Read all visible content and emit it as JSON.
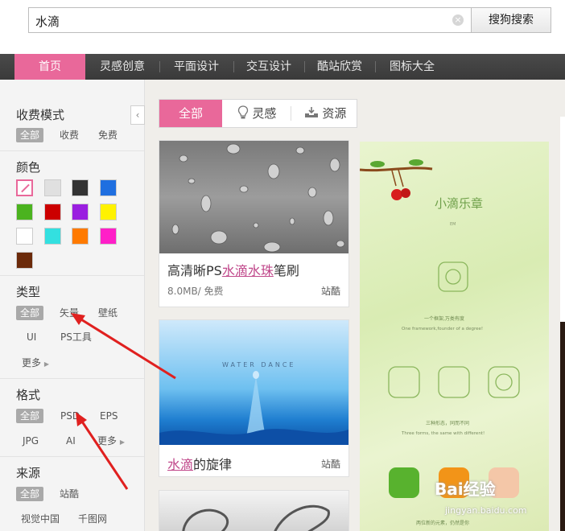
{
  "search": {
    "value": "水滴",
    "clear_icon": "close-circle-icon",
    "button_label": "搜狗搜索"
  },
  "nav": {
    "items": [
      "首页",
      "灵感创意",
      "平面设计",
      "交互设计",
      "酷站欣赏",
      "图标大全"
    ],
    "active": "首页",
    "accent": "#e9689a"
  },
  "sidebar": {
    "collapse_icon": "chevron-left-icon",
    "fee": {
      "title": "收费模式",
      "options": [
        "全部",
        "收费",
        "免费"
      ]
    },
    "color": {
      "title": "颜色",
      "swatches": [
        "none",
        "#e0e0e0",
        "#333333",
        "#1f6fe0",
        "#4bb31f",
        "#cc0000",
        "#9a1fe0",
        "#fff200",
        "#ffffff",
        "#33e0e0",
        "#ff7a00",
        "#ff1fc8",
        "#6b2a0a"
      ]
    },
    "type": {
      "title": "类型",
      "options": [
        "全部",
        "矢量",
        "壁纸",
        "UI",
        "PS工具"
      ],
      "more": "更多"
    },
    "format": {
      "title": "格式",
      "options": [
        "全部",
        "PSD",
        "EPS",
        "JPG",
        "AI"
      ],
      "more": "更多"
    },
    "source": {
      "title": "来源",
      "options": [
        "全部",
        "站酷",
        "视觉中国",
        "千图网"
      ]
    }
  },
  "tabs": [
    {
      "label": "全部",
      "icon": ""
    },
    {
      "label": "灵感",
      "icon": "lightbulb-icon"
    },
    {
      "label": "资源",
      "icon": "download-tray-icon"
    }
  ],
  "cards": {
    "c1": {
      "title_pre": "高清晰PS",
      "title_hl": "水滴水珠",
      "title_post": "笔刷",
      "meta": "8.0MB/ 免费",
      "source": "站酷"
    },
    "c2": {
      "title_hl": "水滴",
      "title_post": "的旋律",
      "source": "站酷",
      "image_text": "WATER DANCE"
    },
    "ui": {
      "title": "小滴乐章",
      "em": "EM",
      "line1": "一个框架,万类有度",
      "line1_en": "One framework,founder of a degree!",
      "line2": "三种形态，同而不同",
      "line2_en": "Three forms, the same with different!",
      "line3": "两位新的元素，仍然是你"
    }
  },
  "watermark": {
    "brand": "Bai经验",
    "url": "jingyan.baidu.com"
  }
}
